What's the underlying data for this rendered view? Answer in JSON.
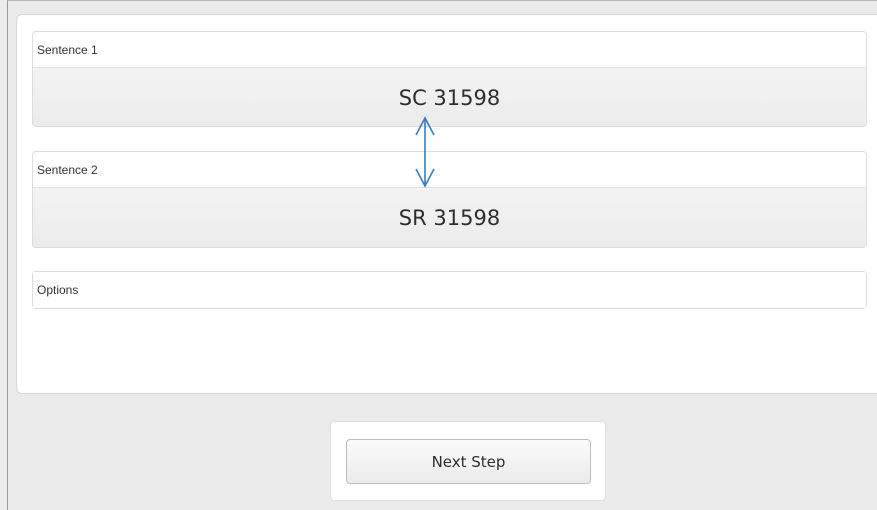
{
  "sentence1": {
    "label": "Sentence 1",
    "value": "SC 31598"
  },
  "sentence2": {
    "label": "Sentence 2",
    "value": "SR 31598"
  },
  "options": {
    "label": "Options"
  },
  "footer": {
    "next_step_label": "Next Step"
  },
  "annotation": {
    "icon": "double-headed-arrow-icon",
    "color": "#3b7bbf"
  }
}
